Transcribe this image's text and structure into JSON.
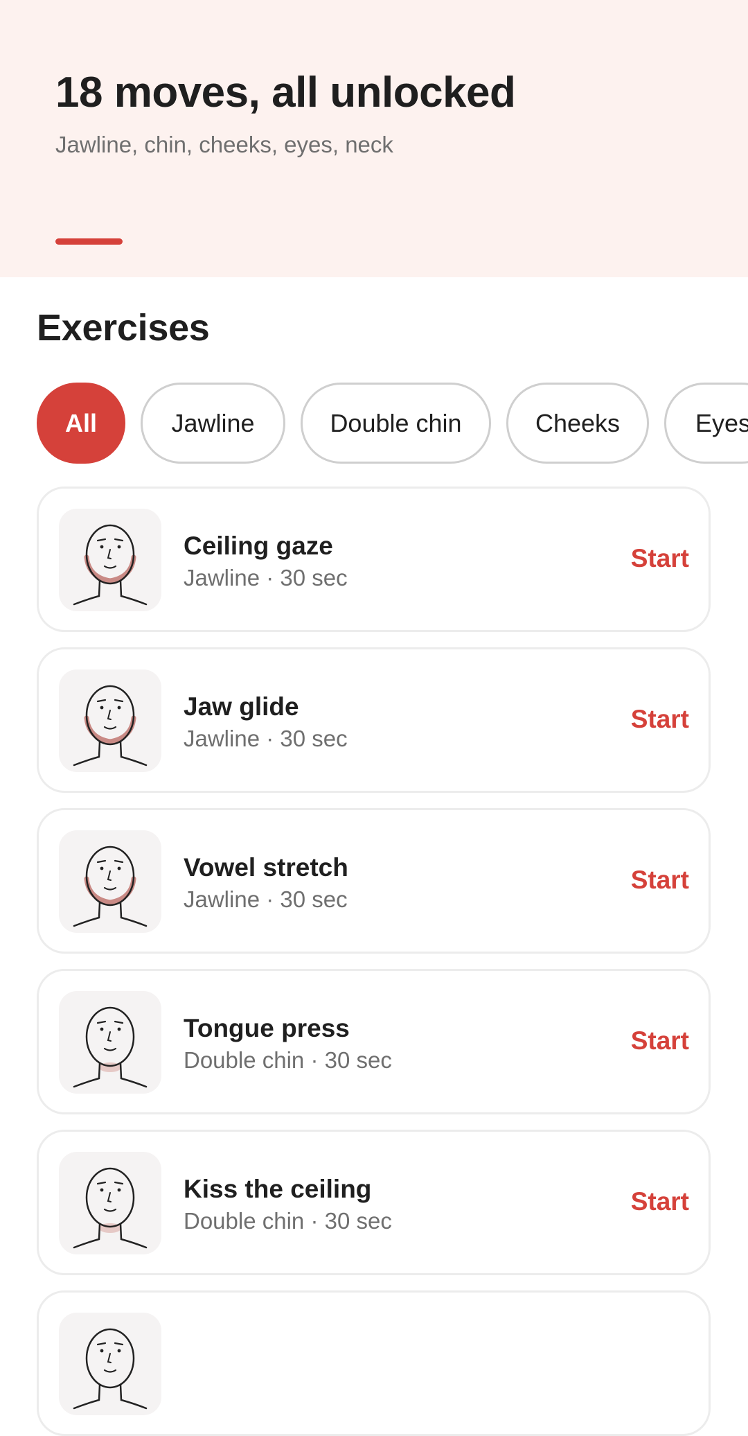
{
  "header": {
    "title": "18 moves, all unlocked",
    "subtitle": "Jawline, chin, cheeks, eyes, neck"
  },
  "section": {
    "title": "Exercises"
  },
  "filters": [
    {
      "label": "All",
      "active": true
    },
    {
      "label": "Jawline",
      "active": false
    },
    {
      "label": "Double chin",
      "active": false
    },
    {
      "label": "Cheeks",
      "active": false
    },
    {
      "label": "Eyes",
      "active": false
    }
  ],
  "exercises": [
    {
      "name": "Ceiling gaze",
      "meta": "Jawline · 30 sec",
      "action": "Start",
      "highlight": "jawline"
    },
    {
      "name": "Jaw glide",
      "meta": "Jawline · 30 sec",
      "action": "Start",
      "highlight": "jawline"
    },
    {
      "name": "Vowel stretch",
      "meta": "Jawline · 30 sec",
      "action": "Start",
      "highlight": "jawline"
    },
    {
      "name": "Tongue press",
      "meta": "Double chin · 30 sec",
      "action": "Start",
      "highlight": "chin"
    },
    {
      "name": "Kiss the ceiling",
      "meta": "Double chin · 30 sec",
      "action": "Start",
      "highlight": "chin"
    },
    {
      "name": "",
      "meta": "",
      "action": "",
      "highlight": "none"
    }
  ],
  "colors": {
    "accent": "#d5413a",
    "hero_background": "#fdf2ef",
    "highlight_jawline": "#c98a85",
    "highlight_chin": "#e6c9c6"
  },
  "icons": {
    "exercise_thumbnail": "face-outline-icon"
  }
}
